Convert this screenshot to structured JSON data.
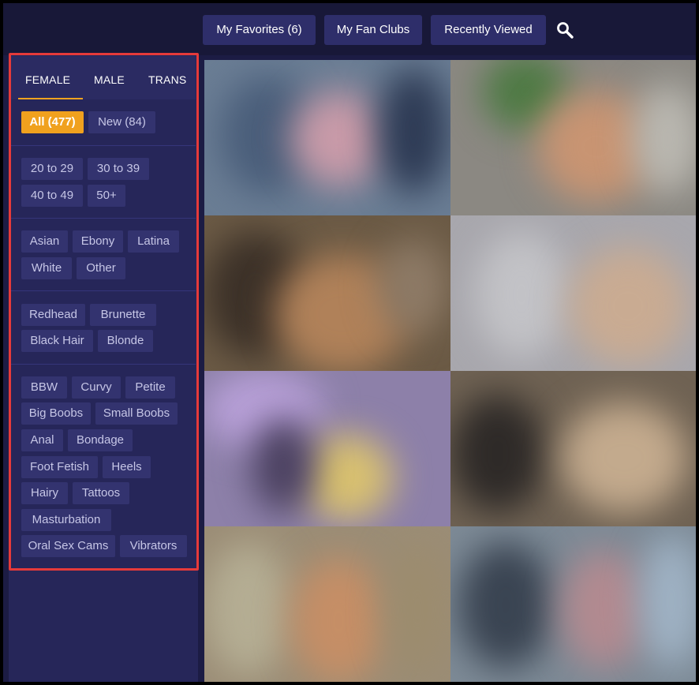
{
  "header": {
    "buttons": [
      {
        "label": "My Favorites (6)"
      },
      {
        "label": "My Fan Clubs"
      },
      {
        "label": "Recently Viewed"
      }
    ]
  },
  "sidebar": {
    "tabs": [
      {
        "label": "FEMALE",
        "active": true
      },
      {
        "label": "MALE",
        "active": false
      },
      {
        "label": "TRANS",
        "active": false
      }
    ],
    "filters": {
      "status": [
        "All (477)",
        "New (84)"
      ],
      "age": [
        "20 to 29",
        "30 to 39",
        "40 to 49",
        "50+"
      ],
      "ethnicity": [
        "Asian",
        "Ebony",
        "Latina",
        "White",
        "Other"
      ],
      "hair": [
        "Redhead",
        "Brunette",
        "Black Hair",
        "Blonde"
      ],
      "tags": [
        "BBW",
        "Curvy",
        "Petite",
        "Big Boobs",
        "Small Boobs",
        "Anal",
        "Bondage",
        "Foot Fetish",
        "Heels",
        "Hairy",
        "Tattoos",
        "Masturbation",
        "Oral Sex Cams",
        "Vibrators"
      ]
    }
  },
  "colors": {
    "background": "#1c1c44",
    "header_button": "#2e2e6a",
    "accent": "#f0a11e",
    "highlight_outline": "#e63a3a"
  },
  "icons": {
    "search": "search-icon"
  }
}
